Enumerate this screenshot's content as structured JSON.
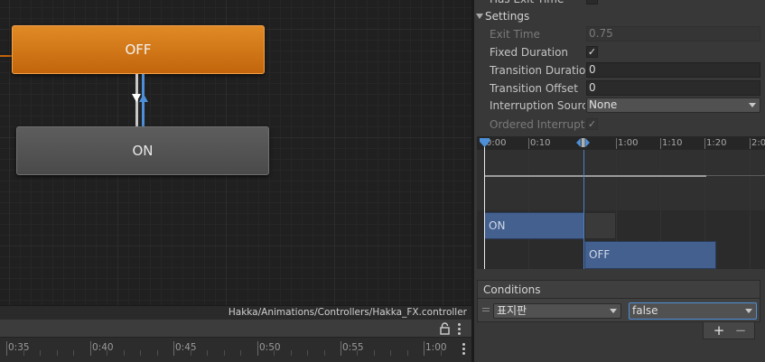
{
  "graph": {
    "states": {
      "off": "OFF",
      "on": "ON"
    },
    "path": "Hakka/Animations/Controllers/Hakka_FX.controller"
  },
  "bottom_ruler": {
    "labels": [
      "0:35",
      "0:40",
      "0:45",
      "0:50",
      "0:55",
      "1:00"
    ]
  },
  "inspector": {
    "has_exit_time": {
      "label": "Has Exit Time",
      "checked": false
    },
    "settings": {
      "header": "Settings",
      "exit_time": {
        "label": "Exit Time",
        "value": "0.75"
      },
      "fixed_duration": {
        "label": "Fixed Duration",
        "checked": true,
        "mark": "✓"
      },
      "transition_duration": {
        "label": "Transition Duration",
        "value": "0"
      },
      "transition_offset": {
        "label": "Transition Offset",
        "value": "0"
      },
      "interruption_source": {
        "label": "Interruption Source",
        "value": "None"
      },
      "ordered_interruption": {
        "label": "Ordered Interruption",
        "checked": true,
        "mark": "✓"
      }
    },
    "preview": {
      "ruler_labels": [
        "0:00",
        "0:10",
        "",
        "1:00",
        "1:10",
        "1:20",
        "2:0"
      ],
      "bars": {
        "on": "ON",
        "off": "OFF"
      }
    },
    "conditions": {
      "header": "Conditions",
      "items": [
        {
          "parameter": "표지판",
          "value": "false"
        }
      ],
      "add": "+",
      "remove": "−"
    }
  },
  "colors": {
    "state_off": "#c2650c",
    "state_on": "#4a4a4a",
    "accent_blue": "#4d8fd8",
    "bar_blue": "#43608f"
  },
  "icons": [
    "lock-icon",
    "kebab-menu-icon",
    "fold-triangle-icon",
    "checkmark-icon",
    "dropdown-arrow-icon",
    "drag-handle-icon",
    "playhead-marker-icon"
  ]
}
